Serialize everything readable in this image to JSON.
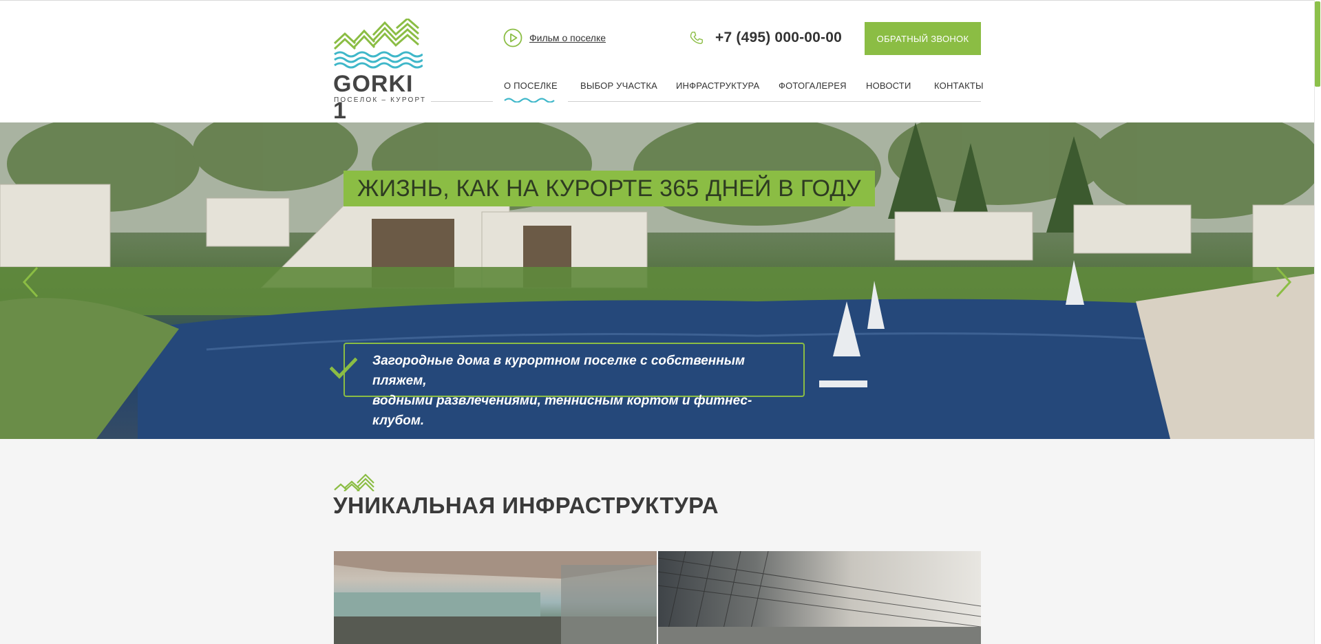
{
  "header": {
    "logo": {
      "name": "GORKI 1",
      "subtitle": "ПОСЕЛОК – КУРОРТ"
    },
    "film_link": "Фильм о поселке",
    "phone": "+7 (495) 000-00-00",
    "callback_label": "ОБРАТНЫЙ ЗВОНОК",
    "nav": [
      {
        "label": "О ПОСЕЛКЕ",
        "active": true
      },
      {
        "label": "ВЫБОР УЧАСТКА"
      },
      {
        "label": "ИНФРАСТРУКТУРА"
      },
      {
        "label": "ФОТОГАЛЕРЕЯ"
      },
      {
        "label": "НОВОСТИ"
      },
      {
        "label": "КОНТАКТЫ"
      }
    ]
  },
  "hero": {
    "title": "ЖИЗНЬ, КАК НА КУРОРТЕ 365 ДНЕЙ В ГОДУ",
    "desc_line1": "Загородные дома в курортном поселке с собственным пляжем,",
    "desc_line2": "водными развлечениями, теннисным кортом и фитнес-клубом."
  },
  "section": {
    "title": "УНИКАЛЬНАЯ ИНФРАСТРУКТУРА"
  },
  "colors": {
    "accent": "#8bbd44",
    "water": "#3fb7c9",
    "text": "#3a3a3a"
  }
}
